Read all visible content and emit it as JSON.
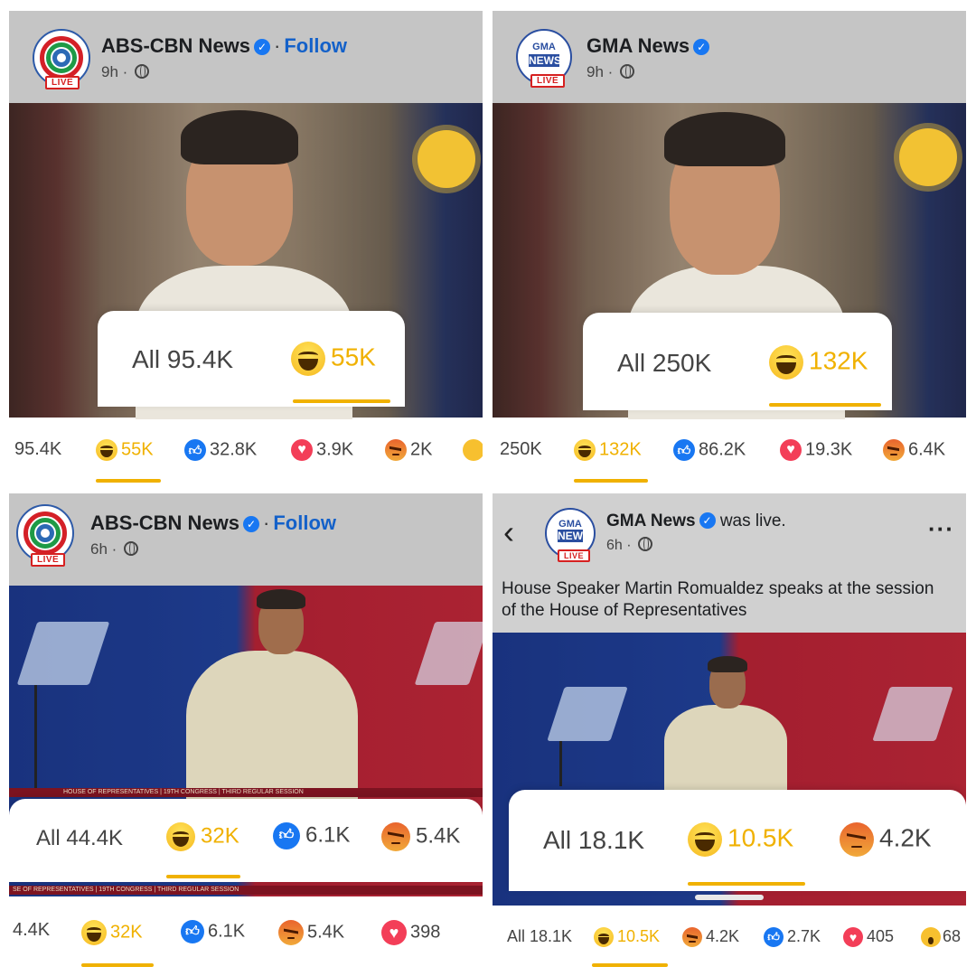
{
  "panels": [
    {
      "page_name": "ABS-CBN News",
      "follow": "Follow",
      "time": "9h",
      "live_badge": "LIVE",
      "card": {
        "all": "All 95.4K",
        "haha": "55K"
      },
      "strip": {
        "all": "95.4K",
        "haha": "55K",
        "like": "32.8K",
        "love": "3.9K",
        "angry": "2K"
      }
    },
    {
      "page_name": "GMA News",
      "time": "9h",
      "live_badge": "LIVE",
      "logo_top": "GMA",
      "logo_mid": "NEWS",
      "card": {
        "all": "All 250K",
        "haha": "132K"
      },
      "strip": {
        "all": "250K",
        "haha": "132K",
        "like": "86.2K",
        "love": "19.3K",
        "angry": "6.4K"
      }
    },
    {
      "page_name": "ABS-CBN News",
      "follow": "Follow",
      "time": "6h",
      "live_badge": "LIVE",
      "banner": "HOUSE OF REPRESENTATIVES | 19TH CONGRESS | THIRD REGULAR SESSION",
      "banner2": "SE OF REPRESENTATIVES | 19TH CONGRESS | THIRD REGULAR SESSION",
      "card": {
        "all": "All 44.4K",
        "haha": "32K",
        "like": "6.1K",
        "angry": "5.4K"
      },
      "strip": {
        "all": "4.4K",
        "haha": "32K",
        "like": "6.1K",
        "angry": "5.4K",
        "love": "398"
      }
    },
    {
      "page_name": "GMA News",
      "was_live": "was live.",
      "time": "6h",
      "live_badge": "LIVE",
      "logo_top": "GMA",
      "logo_mid": "NEWS",
      "caption": "House Speaker Martin Romualdez speaks at the session of the House of Representatives",
      "card": {
        "all": "All 18.1K",
        "haha": "10.5K",
        "angry": "4.2K"
      },
      "strip": {
        "all": "All 18.1K",
        "haha": "10.5K",
        "angry": "4.2K",
        "like": "2.7K",
        "love": "405",
        "wow": "68"
      }
    }
  ],
  "colors": {
    "accent": "#f0b100",
    "facebook_blue": "#1877f2",
    "follow_blue": "#1461c9"
  },
  "icons": [
    "abs-cbn-logo",
    "gma-logo",
    "verified-badge-icon",
    "globe-icon",
    "haha-icon",
    "like-icon",
    "love-icon",
    "angry-icon",
    "wow-icon",
    "care-icon",
    "back-icon",
    "more-icon"
  ]
}
